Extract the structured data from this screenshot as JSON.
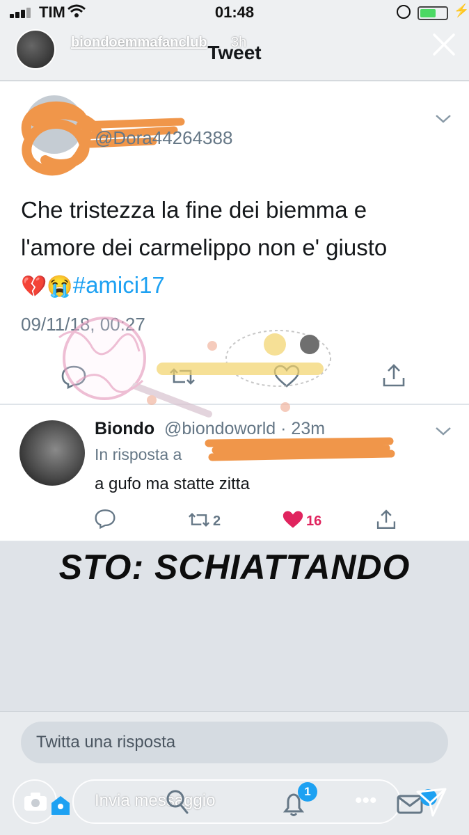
{
  "status_bar": {
    "carrier": "TIM",
    "time": "01:48"
  },
  "story": {
    "username": "biondoemmafanclub",
    "age": "3h"
  },
  "screen": {
    "title": "Tweet"
  },
  "tweet": {
    "handle": "@Dora44264388",
    "text_line1": "Che tristezza la fine dei biemma e",
    "text_line2": "l'amore dei carmelippo non e' giusto",
    "emoji": "💔😭",
    "hashtag": "#amici17",
    "date": "09/11/18, 00:27"
  },
  "reply": {
    "name": "Biondo",
    "handle_time": "@biondoworld · 23m",
    "in_reply_prefix": "In risposta a",
    "text": "a gufo ma statte zitta",
    "retweets": "2",
    "likes": "16"
  },
  "banner": "STO: SCHIATTANDO",
  "compose": {
    "placeholder": "Twitta una risposta"
  },
  "story_footer": {
    "message_placeholder": "Invia messaggio",
    "notification_count": "1"
  },
  "colors": {
    "twitter_blue": "#1da1f2",
    "like_red": "#e0245e",
    "scribble_orange": "#f0964a"
  }
}
